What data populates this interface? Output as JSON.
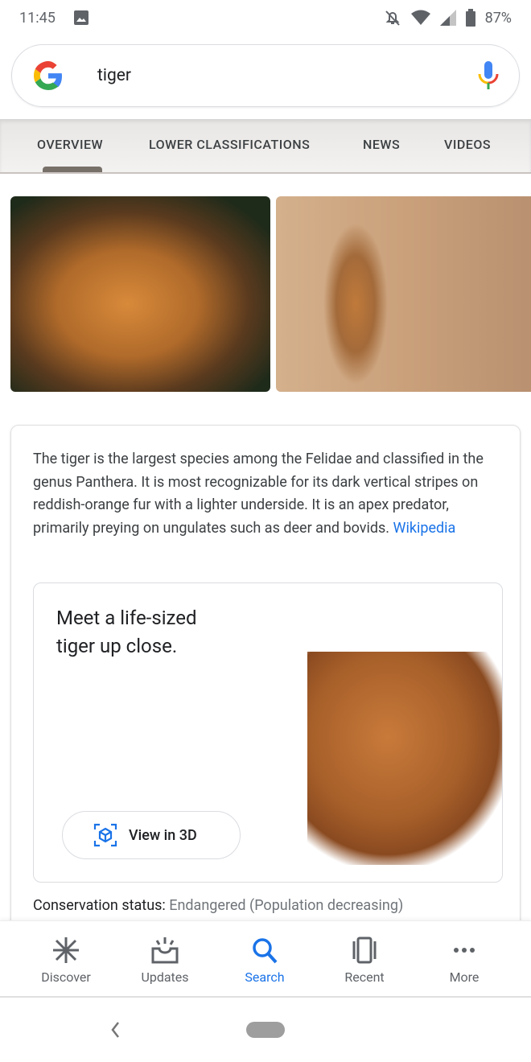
{
  "status": {
    "time": "11:45",
    "battery": "87%"
  },
  "search": {
    "query": "tiger"
  },
  "tabs": [
    {
      "label": "OVERVIEW",
      "active": true
    },
    {
      "label": "LOWER CLASSIFICATIONS"
    },
    {
      "label": "NEWS"
    },
    {
      "label": "VIDEOS"
    }
  ],
  "knowledge": {
    "description": "The tiger is the largest species among the Felidae and classified in the genus Panthera. It is most recognizable for its dark vertical stripes on reddish-orange fur with a lighter underside. It is an apex predator, primarily preying on ungulates such as deer and bovids.",
    "source": "Wikipedia",
    "ar_title": "Meet a life-sized tiger up close.",
    "ar_button": "View in 3D",
    "conservation_label": "Conservation status:",
    "conservation_value": "Endangered (Population decreasing)"
  },
  "bottom_nav": [
    {
      "label": "Discover",
      "icon": "asterisk-icon"
    },
    {
      "label": "Updates",
      "icon": "updates-icon"
    },
    {
      "label": "Search",
      "icon": "search-icon",
      "active": true
    },
    {
      "label": "Recent",
      "icon": "recent-icon"
    },
    {
      "label": "More",
      "icon": "more-icon"
    }
  ],
  "colors": {
    "accent": "#1a73e8"
  }
}
